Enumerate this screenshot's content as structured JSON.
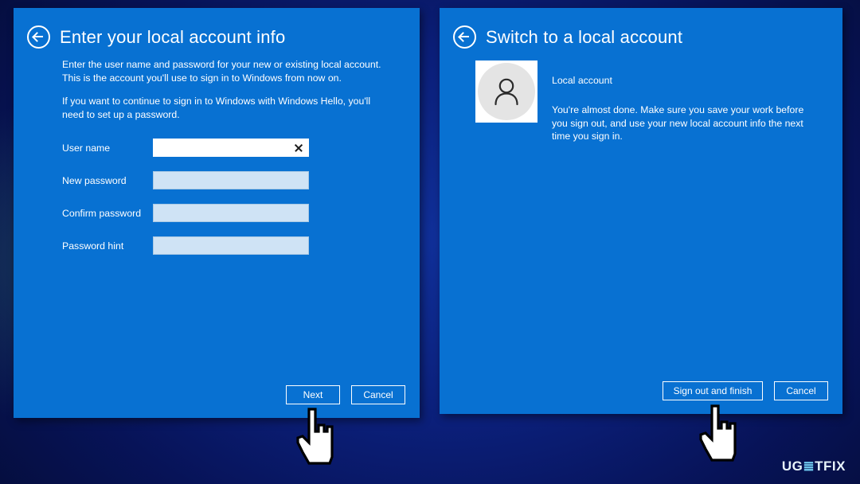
{
  "left_panel": {
    "back_icon": "back-arrow-icon",
    "title": "Enter your local account info",
    "paragraphs": [
      "Enter the user name and password for your new or existing local account. This is the account you'll use to sign in to Windows from now on.",
      "If you want to continue to sign in to Windows with Windows Hello, you'll need to set up a password."
    ],
    "fields": [
      {
        "label": "User name",
        "value": "",
        "placeholder": "",
        "state": "focused",
        "clear_icon": "close-x-icon"
      },
      {
        "label": "New password",
        "value": "",
        "placeholder": "",
        "state": "filled",
        "clear_icon": ""
      },
      {
        "label": "Confirm password",
        "value": "",
        "placeholder": "",
        "state": "filled",
        "clear_icon": ""
      },
      {
        "label": "Password hint",
        "value": "",
        "placeholder": "",
        "state": "filled",
        "clear_icon": ""
      }
    ],
    "buttons": {
      "primary": "Next",
      "secondary": "Cancel"
    }
  },
  "right_panel": {
    "back_icon": "back-arrow-icon",
    "title": "Switch to a local account",
    "avatar_icon": "user-avatar-icon",
    "account_name": "Local account",
    "account_description": "You're almost done. Make sure you save your work before you sign out, and use your new local account info the next time you sign in.",
    "buttons": {
      "primary": "Sign out and finish",
      "secondary": "Cancel"
    }
  },
  "watermark": {
    "prefix": "UG",
    "mark": "≣",
    "suffix": "TFIX"
  },
  "cursors": [
    {
      "name": "hand-pointer-cursor-left"
    },
    {
      "name": "hand-pointer-cursor-right"
    }
  ],
  "colors": {
    "panel_blue": "#0871d2",
    "desktop_navy": "#0b1f79",
    "field_fill": "#cfe3f5",
    "field_focus": "#ffffff",
    "text_white": "#ffffff"
  }
}
